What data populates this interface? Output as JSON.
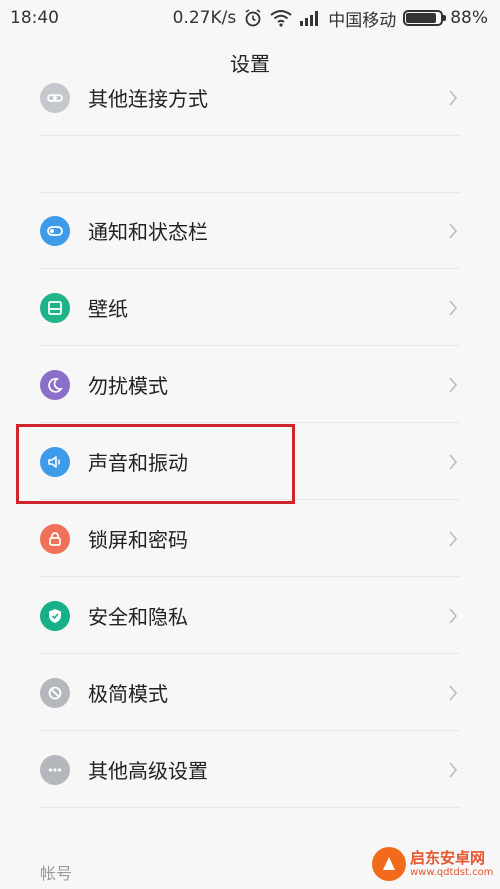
{
  "status_bar": {
    "time": "18:40",
    "net_speed": "0.27K/s",
    "carrier": "中国移动",
    "battery_percent": "88%",
    "battery_level": 0.88,
    "icons": [
      "alarm-icon",
      "wifi-icon",
      "signal-icon",
      "battery-icon"
    ]
  },
  "header": {
    "title": "设置"
  },
  "items": [
    {
      "label": "其他连接方式",
      "icon": "link-icon",
      "color": "#c4c8cc"
    },
    {
      "label": "通知和状态栏",
      "icon": "toggle-icon",
      "color": "#3d9be9"
    },
    {
      "label": "壁纸",
      "icon": "wallpaper-icon",
      "color": "#1fb38a"
    },
    {
      "label": "勿扰模式",
      "icon": "moon-icon",
      "color": "#8c6fc8"
    },
    {
      "label": "声音和振动",
      "icon": "speaker-icon",
      "color": "#3d9be9"
    },
    {
      "label": "锁屏和密码",
      "icon": "lock-icon",
      "color": "#f07059"
    },
    {
      "label": "安全和隐私",
      "icon": "shield-icon",
      "color": "#17b08a"
    },
    {
      "label": "极简模式",
      "icon": "minimal-icon",
      "color": "#b4b8bd"
    },
    {
      "label": "其他高级设置",
      "icon": "more-icon",
      "color": "#b4b8bd"
    }
  ],
  "section": {
    "account": "帐号"
  },
  "highlight_color": "#d0252b",
  "watermark": {
    "name": "启东安卓网",
    "url": "www.qdtdst.com"
  }
}
